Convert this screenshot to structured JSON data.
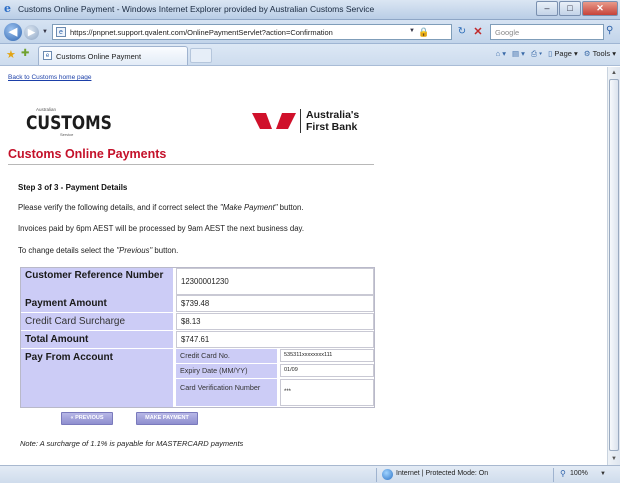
{
  "window": {
    "title": "Customs Online Payment - Windows Internet Explorer provided by Australian Customs Service",
    "minimize": "–",
    "maximize": "□",
    "close": "✕"
  },
  "address_bar": {
    "url": "https://pnpnet.support.qvalent.com/OnlinePaymentServlet?action=Confirmation",
    "search_placeholder": "Google"
  },
  "command_bar": {
    "tab_label": "Customs Online Payment",
    "page_menu": "Page",
    "tools_menu": "Tools"
  },
  "page": {
    "back_link": "Back to Customs home page",
    "customs_logo": {
      "small_text": "Australian",
      "main_text": "CUSTOMS",
      "service_text": "Service"
    },
    "bank_logo": {
      "line1": "Australia's",
      "line2": "First Bank",
      "color": "#d0112b"
    },
    "heading": "Customs Online Payments",
    "step": "Step 3 of 3 - Payment Details",
    "instructions": {
      "p1_pre": "Please verify the following details, and if correct select the ",
      "p1_em": "\"Make Payment\"",
      "p1_post": " button.",
      "p2": "Invoices paid by 6pm AEST will be processed by 9am AEST the next business day.",
      "p3_pre": "To change details select the ",
      "p3_em": "\"Previous\"",
      "p3_post": " button."
    },
    "details": {
      "customer_ref_label": "Customer Reference Number",
      "customer_ref_value": "12300001230",
      "payment_amount_label": "Payment Amount",
      "payment_amount_value": "$739.48",
      "surcharge_label": "Credit Card Surcharge",
      "surcharge_value": "$8.13",
      "total_label": "Total Amount",
      "total_value": "$747.61",
      "pay_from_label": "Pay From Account",
      "card_no_label": "Credit Card No.",
      "card_no_value": "535311xxxxxxxx111",
      "expiry_label": "Expiry Date (MM/YY)",
      "expiry_value": "01/09",
      "cvn_label": "Card Verification Number",
      "cvn_value": "***"
    },
    "buttons": {
      "previous": "« PREVIOUS",
      "make_payment": "MAKE PAYMENT"
    },
    "note": "Note: A surcharge of 1.1% is payable for MASTERCARD payments"
  },
  "status_bar": {
    "zone": "Internet | Protected Mode: On",
    "zoom": "100%"
  },
  "colors": {
    "heading_red": "#c4112a",
    "label_bg": "#ccccf6",
    "button_bg": "#8e8ecf"
  }
}
